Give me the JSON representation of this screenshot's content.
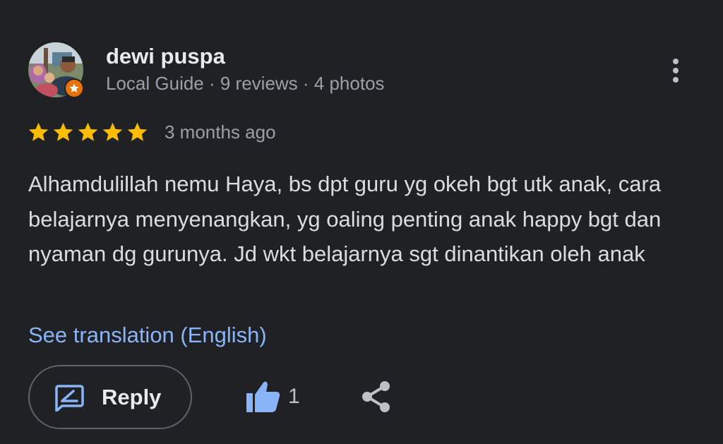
{
  "review": {
    "author": {
      "name": "dewi puspa",
      "meta": "Local Guide · 9 reviews · 4 photos",
      "avatar": "profile-photo",
      "badge": "local-guide-star-icon"
    },
    "rating": 5,
    "date": "3 months ago",
    "text": "Alhamdulillah nemu Haya, bs dpt guru yg okeh bgt utk anak, cara belajarnya menyenangkan, yg oaling penting anak happy bgt dan nyaman dg gurunya. Jd wkt belajarnya sgt dinantikan oleh anak",
    "translate_link": "See translation (English)"
  },
  "actions": {
    "more_icon": "more-vert-icon",
    "reply_label": "Reply",
    "reply_icon": "reply-icon",
    "like_icon": "thumb-up-icon",
    "like_count": "1",
    "share_icon": "share-icon"
  },
  "colors": {
    "background": "#202124",
    "star": "#fbbc04",
    "link": "#8ab4f8",
    "badge": "#e8710a",
    "accent_icon": "#8ab4f8"
  }
}
